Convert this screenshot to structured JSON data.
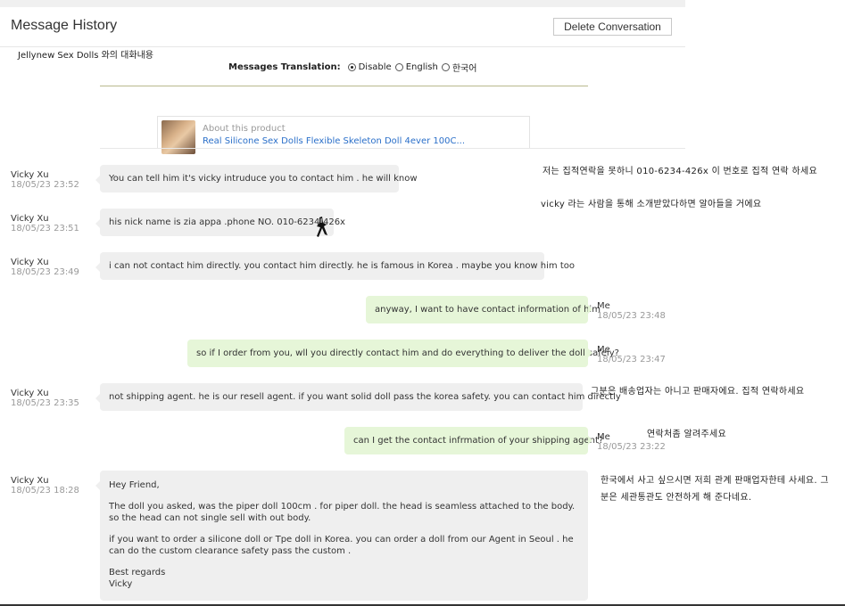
{
  "header": {
    "title": "Message History",
    "delete_label": "Delete Conversation",
    "subtitle": "Jellynew Sex Dolls 와의 대화내용"
  },
  "translation": {
    "label": "Messages Translation:",
    "options": [
      {
        "label": "Disable",
        "checked": true
      },
      {
        "label": "English",
        "checked": false
      },
      {
        "label": "한국어",
        "checked": false
      }
    ]
  },
  "product": {
    "about": "About this product",
    "name": "Real Silicone Sex Dolls Flexible Skeleton Doll 4ever 100C..."
  },
  "messages": [
    {
      "sender": "Vicky Xu",
      "time": "18/05/23 23:52",
      "text": "You can tell him it's vicky intruduce you to contact him . he will know"
    },
    {
      "sender": "Vicky Xu",
      "time": "18/05/23 23:51",
      "text": "his nick name is  zia appa .phone NO. 010-6234-426x"
    },
    {
      "sender": "Vicky Xu",
      "time": "18/05/23 23:49",
      "text": "i can not contact him directly. you contact him directly. he is famous in Korea . maybe you know him too"
    },
    {
      "sender": "Me",
      "time": "18/05/23 23:48",
      "text": "anyway, I want to have contact information of him"
    },
    {
      "sender": "Me",
      "time": "18/05/23 23:47",
      "text": "so if I order from you, wll you directly contact him and do everything to deliver the doll safely?"
    },
    {
      "sender": "Vicky Xu",
      "time": "18/05/23 23:35",
      "text": "not shipping agent. he is our resell agent. if you want solid doll pass the korea safety. you can contact him directly"
    },
    {
      "sender": "Me",
      "time": "18/05/23 23:22",
      "text": "can I get the contact infrmation of your shipping agent?"
    },
    {
      "sender": "Vicky Xu",
      "time": "18/05/23 18:28",
      "paragraphs": [
        "Hey Friend,",
        "The doll you asked, was the piper doll 100cm . for piper doll.  the head is seamless attached to the body. so the head can not single sell with out body.",
        "if you want to order a silicone doll or Tpe doll in Korea. you can order a doll  from our Agent in Seoul . he can do the custom clearance safety pass the custom .",
        "Best regards\nVicky"
      ]
    }
  ],
  "notes": [
    "저는 집적연락을 못하니 010-6234-426x 이 번호로 집적 연락 하세요",
    "vicky 라는 사람을 통해 소개받았다하면 알아들을 거에요",
    "그분은 배송업자는 아니고 판매자에요. 집적 연락하세요",
    "연락처좀 알려주세요",
    "한국에서 사고 싶으시면 저희 관계 판매업자한테 사세요. 그분은 세관통관도 안전하게 해 준다네요."
  ]
}
